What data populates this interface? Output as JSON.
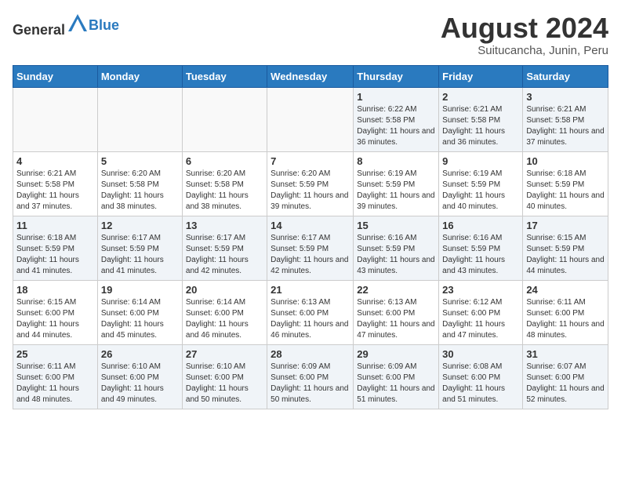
{
  "header": {
    "logo_general": "General",
    "logo_blue": "Blue",
    "title": "August 2024",
    "subtitle": "Suitucancha, Junin, Peru"
  },
  "days_of_week": [
    "Sunday",
    "Monday",
    "Tuesday",
    "Wednesday",
    "Thursday",
    "Friday",
    "Saturday"
  ],
  "weeks": [
    [
      {
        "day": "",
        "info": ""
      },
      {
        "day": "",
        "info": ""
      },
      {
        "day": "",
        "info": ""
      },
      {
        "day": "",
        "info": ""
      },
      {
        "day": "1",
        "info": "Sunrise: 6:22 AM\nSunset: 5:58 PM\nDaylight: 11 hours and 36 minutes."
      },
      {
        "day": "2",
        "info": "Sunrise: 6:21 AM\nSunset: 5:58 PM\nDaylight: 11 hours and 36 minutes."
      },
      {
        "day": "3",
        "info": "Sunrise: 6:21 AM\nSunset: 5:58 PM\nDaylight: 11 hours and 37 minutes."
      }
    ],
    [
      {
        "day": "4",
        "info": "Sunrise: 6:21 AM\nSunset: 5:58 PM\nDaylight: 11 hours and 37 minutes."
      },
      {
        "day": "5",
        "info": "Sunrise: 6:20 AM\nSunset: 5:58 PM\nDaylight: 11 hours and 38 minutes."
      },
      {
        "day": "6",
        "info": "Sunrise: 6:20 AM\nSunset: 5:58 PM\nDaylight: 11 hours and 38 minutes."
      },
      {
        "day": "7",
        "info": "Sunrise: 6:20 AM\nSunset: 5:59 PM\nDaylight: 11 hours and 39 minutes."
      },
      {
        "day": "8",
        "info": "Sunrise: 6:19 AM\nSunset: 5:59 PM\nDaylight: 11 hours and 39 minutes."
      },
      {
        "day": "9",
        "info": "Sunrise: 6:19 AM\nSunset: 5:59 PM\nDaylight: 11 hours and 40 minutes."
      },
      {
        "day": "10",
        "info": "Sunrise: 6:18 AM\nSunset: 5:59 PM\nDaylight: 11 hours and 40 minutes."
      }
    ],
    [
      {
        "day": "11",
        "info": "Sunrise: 6:18 AM\nSunset: 5:59 PM\nDaylight: 11 hours and 41 minutes."
      },
      {
        "day": "12",
        "info": "Sunrise: 6:17 AM\nSunset: 5:59 PM\nDaylight: 11 hours and 41 minutes."
      },
      {
        "day": "13",
        "info": "Sunrise: 6:17 AM\nSunset: 5:59 PM\nDaylight: 11 hours and 42 minutes."
      },
      {
        "day": "14",
        "info": "Sunrise: 6:17 AM\nSunset: 5:59 PM\nDaylight: 11 hours and 42 minutes."
      },
      {
        "day": "15",
        "info": "Sunrise: 6:16 AM\nSunset: 5:59 PM\nDaylight: 11 hours and 43 minutes."
      },
      {
        "day": "16",
        "info": "Sunrise: 6:16 AM\nSunset: 5:59 PM\nDaylight: 11 hours and 43 minutes."
      },
      {
        "day": "17",
        "info": "Sunrise: 6:15 AM\nSunset: 5:59 PM\nDaylight: 11 hours and 44 minutes."
      }
    ],
    [
      {
        "day": "18",
        "info": "Sunrise: 6:15 AM\nSunset: 6:00 PM\nDaylight: 11 hours and 44 minutes."
      },
      {
        "day": "19",
        "info": "Sunrise: 6:14 AM\nSunset: 6:00 PM\nDaylight: 11 hours and 45 minutes."
      },
      {
        "day": "20",
        "info": "Sunrise: 6:14 AM\nSunset: 6:00 PM\nDaylight: 11 hours and 46 minutes."
      },
      {
        "day": "21",
        "info": "Sunrise: 6:13 AM\nSunset: 6:00 PM\nDaylight: 11 hours and 46 minutes."
      },
      {
        "day": "22",
        "info": "Sunrise: 6:13 AM\nSunset: 6:00 PM\nDaylight: 11 hours and 47 minutes."
      },
      {
        "day": "23",
        "info": "Sunrise: 6:12 AM\nSunset: 6:00 PM\nDaylight: 11 hours and 47 minutes."
      },
      {
        "day": "24",
        "info": "Sunrise: 6:11 AM\nSunset: 6:00 PM\nDaylight: 11 hours and 48 minutes."
      }
    ],
    [
      {
        "day": "25",
        "info": "Sunrise: 6:11 AM\nSunset: 6:00 PM\nDaylight: 11 hours and 48 minutes."
      },
      {
        "day": "26",
        "info": "Sunrise: 6:10 AM\nSunset: 6:00 PM\nDaylight: 11 hours and 49 minutes."
      },
      {
        "day": "27",
        "info": "Sunrise: 6:10 AM\nSunset: 6:00 PM\nDaylight: 11 hours and 50 minutes."
      },
      {
        "day": "28",
        "info": "Sunrise: 6:09 AM\nSunset: 6:00 PM\nDaylight: 11 hours and 50 minutes."
      },
      {
        "day": "29",
        "info": "Sunrise: 6:09 AM\nSunset: 6:00 PM\nDaylight: 11 hours and 51 minutes."
      },
      {
        "day": "30",
        "info": "Sunrise: 6:08 AM\nSunset: 6:00 PM\nDaylight: 11 hours and 51 minutes."
      },
      {
        "day": "31",
        "info": "Sunrise: 6:07 AM\nSunset: 6:00 PM\nDaylight: 11 hours and 52 minutes."
      }
    ]
  ]
}
